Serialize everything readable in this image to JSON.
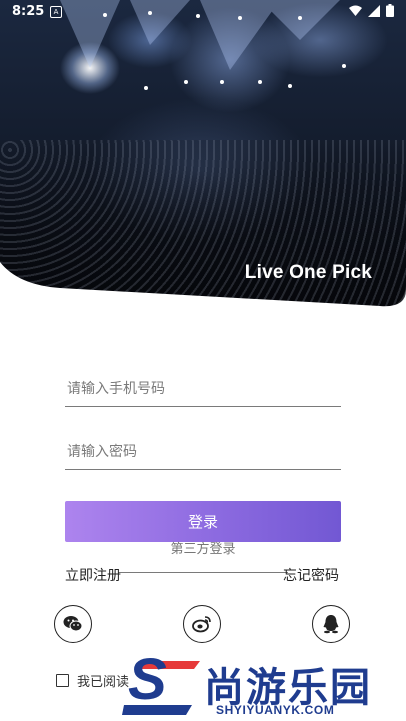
{
  "status_bar": {
    "time": "8:25",
    "notification_icon": "A"
  },
  "hero": {
    "brand": "Live One Pick"
  },
  "form": {
    "phone": {
      "placeholder": "请输入手机号码",
      "value": ""
    },
    "password": {
      "placeholder": "请输入密码",
      "value": ""
    },
    "login_label": "登录",
    "third_party_label": "第三方登录",
    "register_label": "立即注册",
    "forgot_label": "忘记密码"
  },
  "social": [
    {
      "name": "wechat-icon"
    },
    {
      "name": "weibo-icon"
    },
    {
      "name": "qq-icon"
    }
  ],
  "agreement": {
    "text": "我已阅读"
  },
  "watermark": {
    "letter": "S",
    "chinese": "尚游乐园",
    "url": "SHYIYUANYK.COM"
  },
  "colors": {
    "button_start": "#ad84ee",
    "button_end": "#7258d3",
    "watermark": "#1f3c8f"
  }
}
